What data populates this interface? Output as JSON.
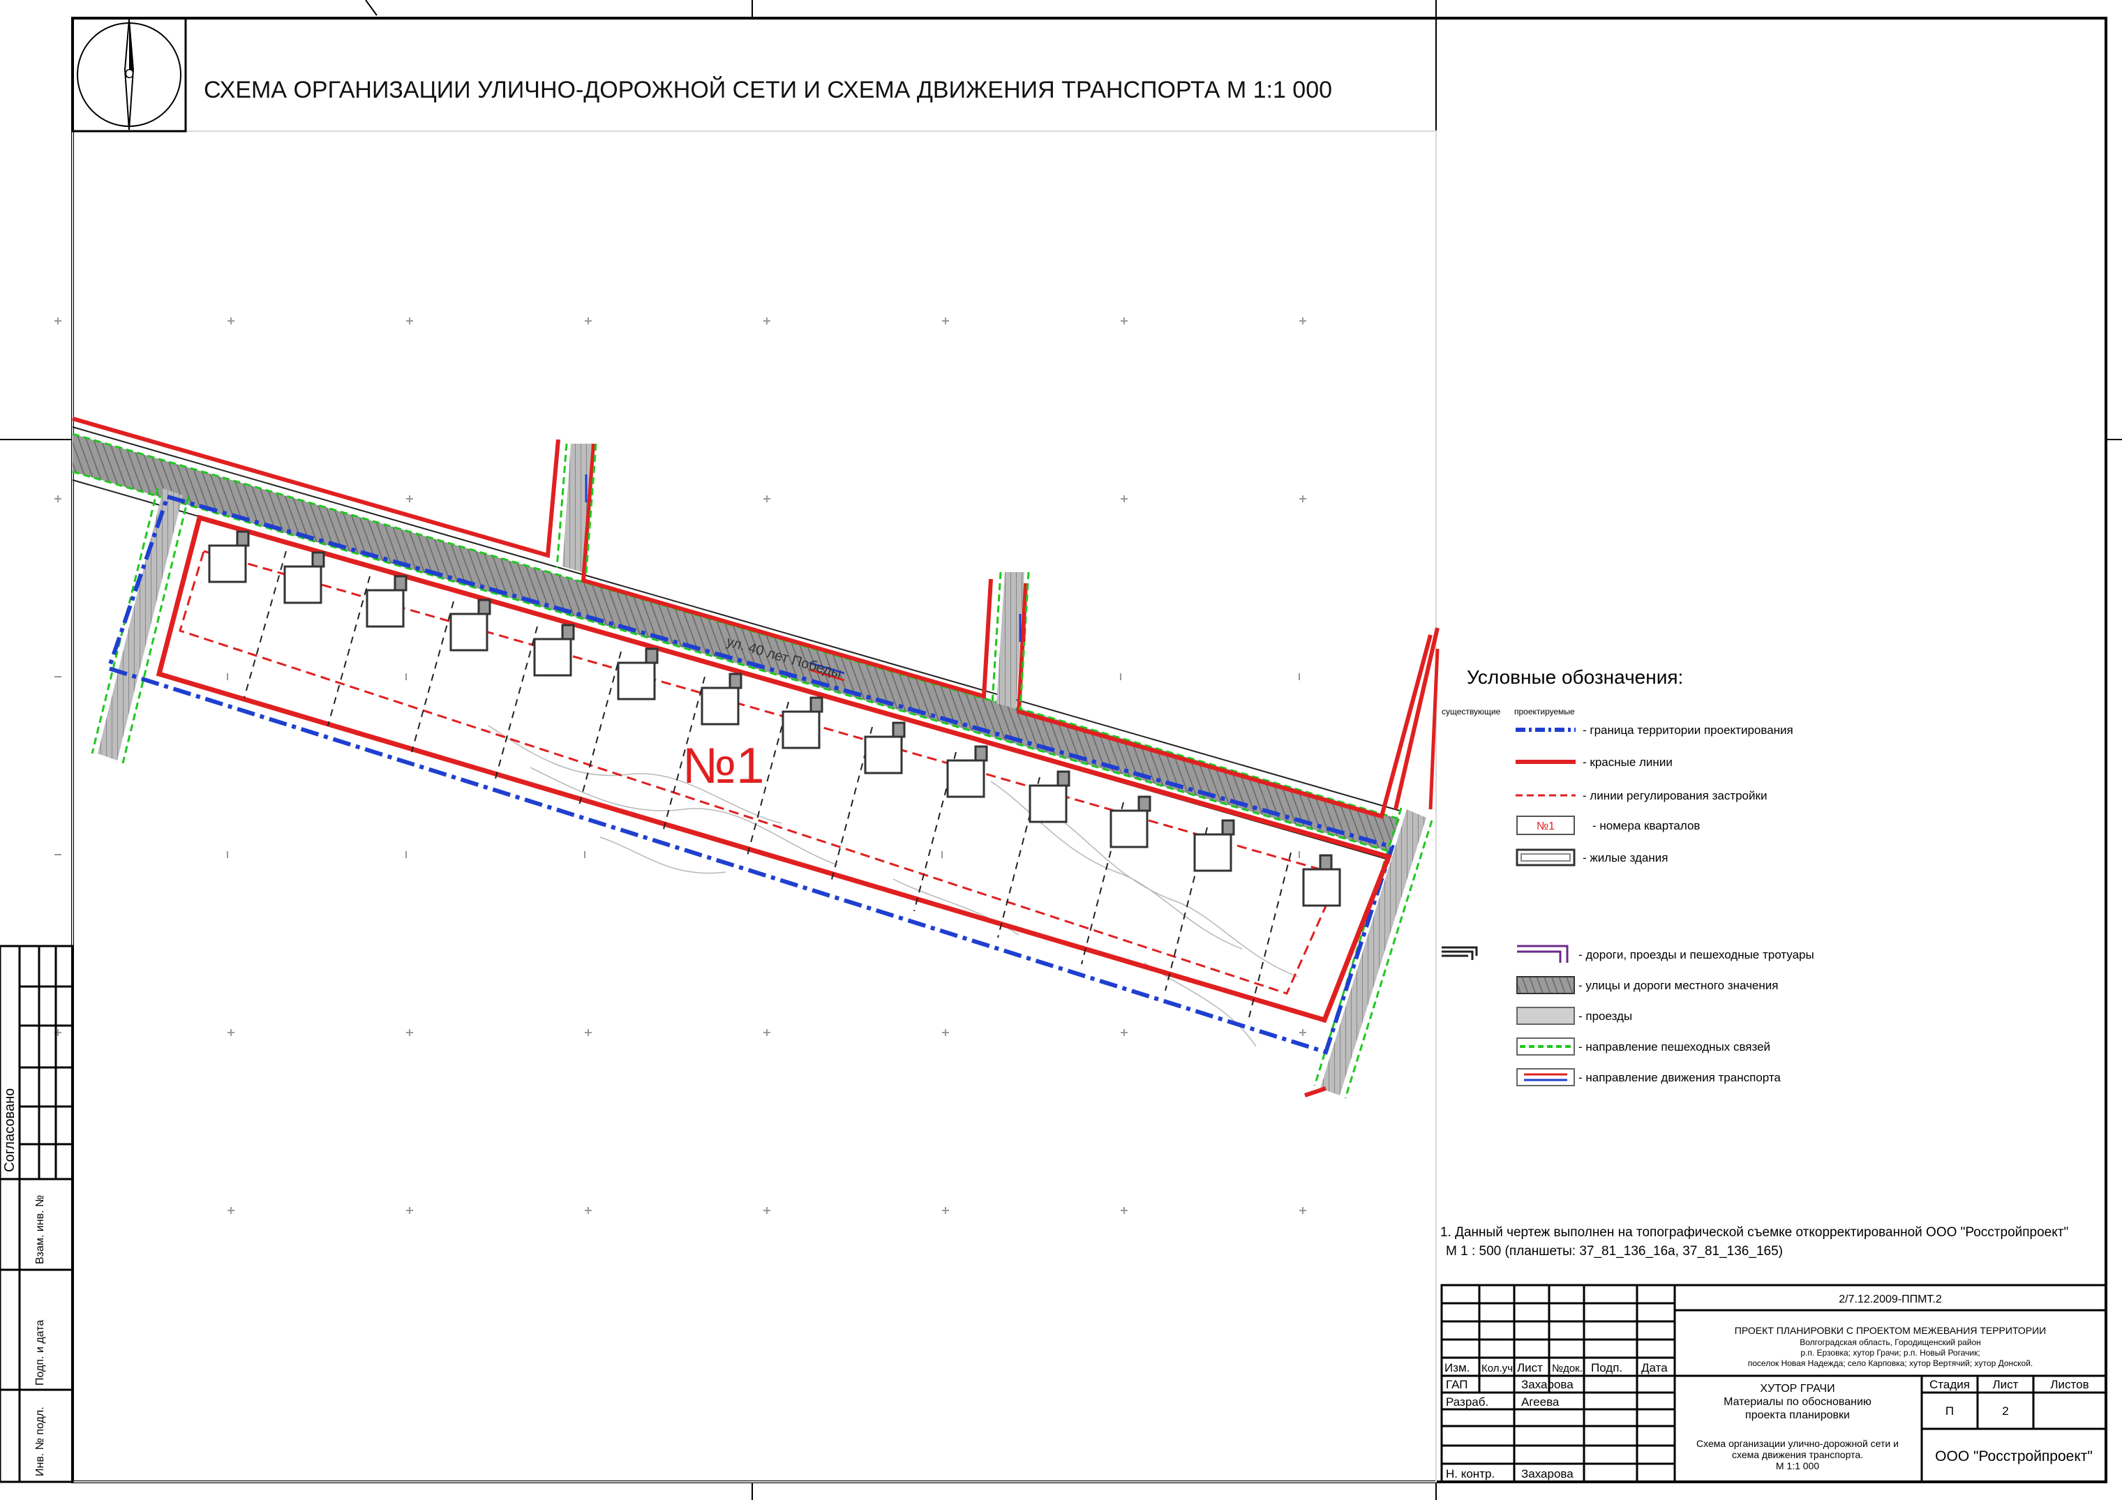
{
  "title": "СХЕМА ОРГАНИЗАЦИИ УЛИЧНО-ДОРОЖНОЙ СЕТИ И СХЕМА ДВИЖЕНИЯ ТРАНСПОРТА  М 1:1 000",
  "north_arrow": {
    "label": "С",
    "icon": "north-arrow-icon"
  },
  "map": {
    "block_number": "№1",
    "street_name": "ул. 40 лет Победы"
  },
  "legend": {
    "title": "Условные обозначения:",
    "col_existing": "существующие",
    "col_projected": "проектируемые",
    "items": [
      {
        "label": "- граница территории проектирования",
        "symbol": "blue-dashdot-line"
      },
      {
        "label": "- красные линии",
        "symbol": "red-line"
      },
      {
        "label": "- линии регулирования застройки",
        "symbol": "red-dashed-line"
      },
      {
        "label": "- номера кварталов",
        "symbol": "block-number",
        "sample": "№1"
      },
      {
        "label": "- жилые здания",
        "symbol": "building"
      },
      {
        "label": "- дороги, проезды и пешеходные тротуары",
        "symbol": "road-lines"
      },
      {
        "label": "- улицы и дороги местного значения",
        "symbol": "dark-gray-road"
      },
      {
        "label": "- проезды",
        "symbol": "light-gray-drive"
      },
      {
        "label": "- направление пешеходных связей",
        "symbol": "green-dashed"
      },
      {
        "label": "- направление движения транспорта",
        "symbol": "traffic-arrows"
      }
    ]
  },
  "note": {
    "line1": "1. Данный чертеж выполнен на топографической съемке откорректированной ООО \"Росстройпроект\"",
    "line2": "М 1 : 500 (планшеты: 37_81_136_16а, 37_81_136_165)"
  },
  "side_stamp": {
    "agreed": "Согласовано",
    "inv_repl": "Взам. инв. №",
    "sign_date": "Подп. и дата",
    "inv_orig": "Инв. № подл."
  },
  "title_block": {
    "doc_code": "2/7.12.2009-ППМТ.2",
    "project_title": "ПРОЕКТ ПЛАНИРОВКИ С ПРОЕКТОМ МЕЖЕВАНИЯ ТЕРРИТОРИИ",
    "project_line2": "Волгоградская область, Городищенский район",
    "project_line3": "р.п. Ерзовка; хутор Грачи; р.п. Новый Рогачик;",
    "project_line4": "поселок Новая Надежда; село Карповка; хутор Вертячий; хутор Донской.",
    "headers": [
      "Изм.",
      "Кол.уч",
      "Лист",
      "№док.",
      "Подп.",
      "Дата"
    ],
    "roles": [
      {
        "role": "ГАП",
        "name": "Захарова"
      },
      {
        "role": "Разраб.",
        "name": "Агеева"
      },
      {
        "role": "Н. контр.",
        "name": "Захарова"
      }
    ],
    "object_line1": "ХУТОР ГРАЧИ",
    "object_line2": "Материалы по обоснованию",
    "object_line3": "проекта планировки",
    "stage_label": "Стадия",
    "sheet_label": "Лист",
    "sheets_label": "Листов",
    "stage_value": "П",
    "sheet_value": "2",
    "sheets_value": "",
    "drawing_line1": "Схема организации улично-дорожной сети и",
    "drawing_line2": "схема движения транспорта.",
    "drawing_line3": "М 1:1 000",
    "company": "ООО \"Росстройпроект\""
  },
  "colors": {
    "red_line": "#e02020",
    "blue_boundary": "#1f3fd0",
    "green_ped": "#1ec81e",
    "road_dark": "#8e8e8e",
    "road_light": "#cfcfcf",
    "frame": "#000000"
  }
}
